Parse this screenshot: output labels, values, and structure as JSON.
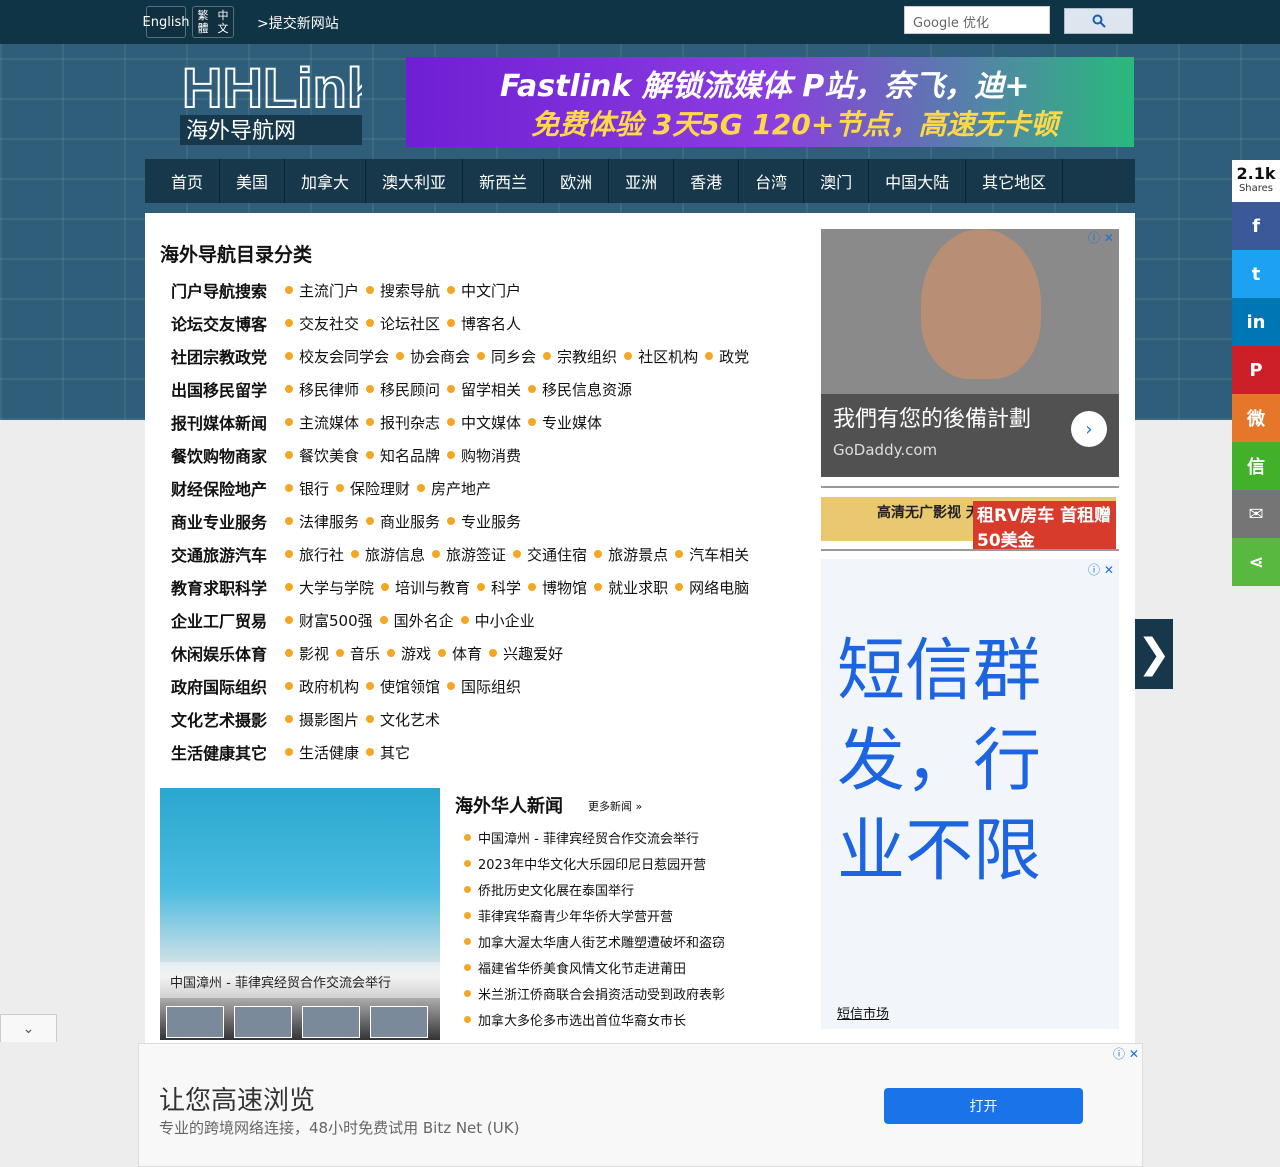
{
  "top": {
    "english": "English",
    "trad1": "繁體",
    "trad2": "中文",
    "submit": ">提交新网站",
    "search_placeholder": "Google 优化",
    "search_icon": "search-icon"
  },
  "logo": {
    "brand": "HHLink",
    "sub": "海外导航网"
  },
  "banner": {
    "line1": "Fastlink 解锁流媒体 P站，奈飞，迪+",
    "line2": "免费体验 3天5G 120+节点，高速无卡顿"
  },
  "nav": [
    "首页",
    "美国",
    "加拿大",
    "澳大利亚",
    "新西兰",
    "欧洲",
    "亚洲",
    "香港",
    "台湾",
    "澳门",
    "中国大陆",
    "其它地区"
  ],
  "directory": {
    "title": "海外导航目录分类",
    "rows": [
      {
        "cat": "门户导航搜索",
        "links": [
          "主流门户",
          "搜索导航",
          "中文门户"
        ]
      },
      {
        "cat": "论坛交友博客",
        "links": [
          "交友社交",
          "论坛社区",
          "博客名人"
        ]
      },
      {
        "cat": "社团宗教政党",
        "links": [
          "校友会同学会",
          "协会商会",
          "同乡会",
          "宗教组织",
          "社区机构",
          "政党"
        ]
      },
      {
        "cat": "出国移民留学",
        "links": [
          "移民律师",
          "移民顾问",
          "留学相关",
          "移民信息资源"
        ]
      },
      {
        "cat": "报刊媒体新闻",
        "links": [
          "主流媒体",
          "报刊杂志",
          "中文媒体",
          "专业媒体"
        ]
      },
      {
        "cat": "餐饮购物商家",
        "links": [
          "餐饮美食",
          "知名品牌",
          "购物消费"
        ]
      },
      {
        "cat": "财经保险地产",
        "links": [
          "银行",
          "保险理财",
          "房产地产"
        ]
      },
      {
        "cat": "商业专业服务",
        "links": [
          "法律服务",
          "商业服务",
          "专业服务"
        ]
      },
      {
        "cat": "交通旅游汽车",
        "links": [
          "旅行社",
          "旅游信息",
          "旅游签证",
          "交通住宿",
          "旅游景点",
          "汽车相关"
        ]
      },
      {
        "cat": "教育求职科学",
        "links": [
          "大学与学院",
          "培训与教育",
          "科学",
          "博物馆",
          "就业求职",
          "网络电脑"
        ]
      },
      {
        "cat": "企业工厂贸易",
        "links": [
          "财富500强",
          "国外名企",
          "中小企业"
        ]
      },
      {
        "cat": "休闲娱乐体育",
        "links": [
          "影视",
          "音乐",
          "游戏",
          "体育",
          "兴趣爱好"
        ]
      },
      {
        "cat": "政府国际组织",
        "links": [
          "政府机构",
          "使馆领馆",
          "国际组织"
        ]
      },
      {
        "cat": "文化艺术摄影",
        "links": [
          "摄影图片",
          "文化艺术"
        ]
      },
      {
        "cat": "生活健康其它",
        "links": [
          "生活健康",
          "其它"
        ]
      }
    ]
  },
  "news": {
    "title": "海外华人新闻",
    "more": "更多新闻 »",
    "caption": "中国漳州 - 菲律宾经贸合作交流会举行",
    "items": [
      "中国漳州 - 菲律宾经贸合作交流会举行",
      "2023年中华文化大乐园印尼日惹园开营",
      "侨批历史文化展在泰国举行",
      "菲律宾华裔青少年华侨大学营开营",
      "加拿大渥太华唐人街艺术雕塑遭破坏和盗窃",
      "福建省华侨美食风情文化节走进莆田",
      "米兰浙江侨商联合会捐资活动受到政府表彰",
      "加拿大多伦多市选出首位华裔女市长"
    ]
  },
  "ads": {
    "godaddy_title": "我們有您的後備計劃",
    "godaddy_site": "GoDaddy.com",
    "rv_left": "高清无广影视 无VIP免费看",
    "rv_right": "租RV房车 首租赠50美金",
    "sms": "短信群发，行业不限",
    "sms_link": "短信市场",
    "bottom_title": "让您高速浏览",
    "bottom_desc": "专业的跨境网络连接，48小时免费试用 Bitz Net (UK)",
    "bottom_btn": "打开",
    "adchoices": "ⓘ ✕"
  },
  "share": {
    "count": "2.1k",
    "label": "Shares",
    "items": [
      {
        "name": "facebook",
        "glyph": "f",
        "color": "#3b5998"
      },
      {
        "name": "twitter",
        "glyph": "t",
        "color": "#1da1f2"
      },
      {
        "name": "linkedin",
        "glyph": "in",
        "color": "#0077b5"
      },
      {
        "name": "pinterest",
        "glyph": "P",
        "color": "#cb2027"
      },
      {
        "name": "weibo",
        "glyph": "微",
        "color": "#e6762a"
      },
      {
        "name": "wechat",
        "glyph": "信",
        "color": "#43b02a"
      },
      {
        "name": "email",
        "glyph": "✉",
        "color": "#757575"
      },
      {
        "name": "sharethis",
        "glyph": "⋖",
        "color": "#59b840"
      }
    ]
  }
}
